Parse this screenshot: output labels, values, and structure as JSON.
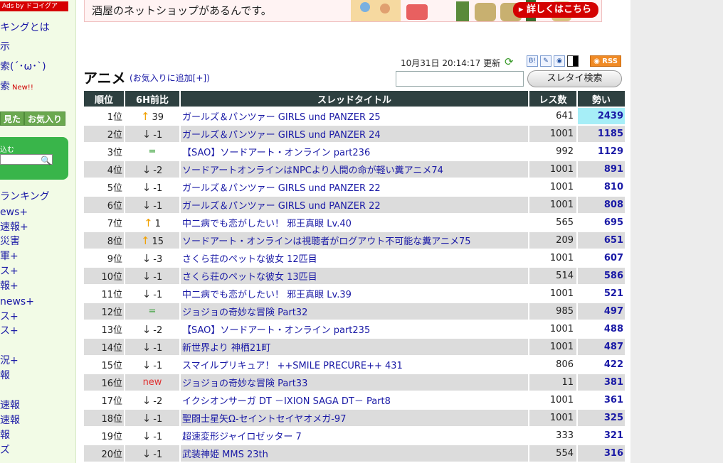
{
  "sidebar": {
    "ads_label": "Ads by ドコイグア",
    "links": [
      {
        "label": "キングとは",
        "new": ""
      },
      {
        "label": "示",
        "new": ""
      },
      {
        "label": "索(´･ω･`)",
        "new": ""
      },
      {
        "label": "索",
        "new": "New!!"
      }
    ],
    "tabs": [
      "見た",
      "お気入り"
    ],
    "search_label": "込む",
    "categories": [
      "ランキング",
      "ews+",
      "速報+",
      "災害",
      "軍+",
      "ス+",
      "報+",
      "news+",
      "ス+",
      "ス+",
      "況+",
      "報",
      "速報",
      "速報",
      "報",
      "ズ"
    ]
  },
  "banner": {
    "text": "酒屋のネットショップがあるんです。",
    "button": "詳しくはこちら"
  },
  "header": {
    "title": "アニメ",
    "add_favorite": "(お気入りに追加[+])",
    "updated": "10月31日 20:14:17 更新",
    "rss": "RSS",
    "search_button": "スレタイ検索",
    "share_icons": [
      "hatena-bookmark-icon",
      "pencil-icon",
      "globe-icon",
      "delicious-icon"
    ]
  },
  "table": {
    "headers": {
      "rank": "順位",
      "change": "6H前比",
      "title": "スレッドタイトル",
      "res": "レス数",
      "momentum": "勢い"
    },
    "rows": [
      {
        "rank": "1位",
        "dir": "up",
        "arrow": "↑",
        "change": "39",
        "title": "ガールズ＆パンツァー GIRLS und PANZER 25",
        "res": "641",
        "momentum": "2439"
      },
      {
        "rank": "2位",
        "dir": "down",
        "arrow": "↓",
        "change": "-1",
        "title": "ガールズ＆パンツァー GIRLS und PANZER 24",
        "res": "1001",
        "momentum": "1185"
      },
      {
        "rank": "3位",
        "dir": "same",
        "arrow": "",
        "change": "=",
        "title": "【SAO】ソードアート・オンライン part236",
        "res": "992",
        "momentum": "1129"
      },
      {
        "rank": "4位",
        "dir": "down",
        "arrow": "↓",
        "change": "-2",
        "title": "ソードアートオンラインはNPCより人間の命が軽い糞アニメ74",
        "res": "1001",
        "momentum": "891"
      },
      {
        "rank": "5位",
        "dir": "down",
        "arrow": "↓",
        "change": "-1",
        "title": "ガールズ＆パンツァー GIRLS und PANZER 22",
        "res": "1001",
        "momentum": "810"
      },
      {
        "rank": "6位",
        "dir": "down",
        "arrow": "↓",
        "change": "-1",
        "title": "ガールズ＆パンツァー GIRLS und PANZER 22",
        "res": "1001",
        "momentum": "808"
      },
      {
        "rank": "7位",
        "dir": "up",
        "arrow": "↑",
        "change": "1",
        "title": "中二病でも恋がしたい！ 邪王真眼 Lv.40",
        "res": "565",
        "momentum": "695"
      },
      {
        "rank": "8位",
        "dir": "up",
        "arrow": "↑",
        "change": "15",
        "title": "ソードアート・オンラインは視聴者がログアウト不可能な糞アニメ75",
        "res": "209",
        "momentum": "651"
      },
      {
        "rank": "9位",
        "dir": "down",
        "arrow": "↓",
        "change": "-3",
        "title": "さくら荘のペットな彼女 12匹目",
        "res": "1001",
        "momentum": "607"
      },
      {
        "rank": "10位",
        "dir": "down",
        "arrow": "↓",
        "change": "-1",
        "title": "さくら荘のペットな彼女 13匹目",
        "res": "514",
        "momentum": "586"
      },
      {
        "rank": "11位",
        "dir": "down",
        "arrow": "↓",
        "change": "-1",
        "title": "中二病でも恋がしたい！ 邪王真眼 Lv.39",
        "res": "1001",
        "momentum": "521"
      },
      {
        "rank": "12位",
        "dir": "same",
        "arrow": "",
        "change": "=",
        "title": "ジョジョの奇妙な冒険 Part32",
        "res": "985",
        "momentum": "497"
      },
      {
        "rank": "13位",
        "dir": "down",
        "arrow": "↓",
        "change": "-2",
        "title": "【SAO】ソードアート・オンライン part235",
        "res": "1001",
        "momentum": "488"
      },
      {
        "rank": "14位",
        "dir": "down",
        "arrow": "↓",
        "change": "-1",
        "title": "新世界より 神栖21町",
        "res": "1001",
        "momentum": "487"
      },
      {
        "rank": "15位",
        "dir": "down",
        "arrow": "↓",
        "change": "-1",
        "title": "スマイルプリキュア！ ++SMILE PRECURE++ 431",
        "res": "806",
        "momentum": "422"
      },
      {
        "rank": "16位",
        "dir": "new",
        "arrow": "",
        "change": "new",
        "title": "ジョジョの奇妙な冒険 Part33",
        "res": "11",
        "momentum": "381"
      },
      {
        "rank": "17位",
        "dir": "down",
        "arrow": "↓",
        "change": "-2",
        "title": "イクシオンサーガ DT －IXION SAGA DT－ Part8",
        "res": "1001",
        "momentum": "361"
      },
      {
        "rank": "18位",
        "dir": "down",
        "arrow": "↓",
        "change": "-1",
        "title": "聖闘士星矢Ω-セイントセイヤオメガ-97",
        "res": "1001",
        "momentum": "325"
      },
      {
        "rank": "19位",
        "dir": "down",
        "arrow": "↓",
        "change": "-1",
        "title": "超速変形ジャイロゼッター 7",
        "res": "333",
        "momentum": "321"
      },
      {
        "rank": "20位",
        "dir": "down",
        "arrow": "↓",
        "change": "-1",
        "title": "武装神姫 MMS 23th",
        "res": "554",
        "momentum": "316"
      }
    ]
  },
  "colors": {
    "header_bg": "#2e4040",
    "link": "#1a1aa6",
    "top_momentum_bg": "#a6eef7",
    "row_alt": "#dcdcdc",
    "up_arrow": "#f0a000",
    "new_mark": "#e03030"
  }
}
